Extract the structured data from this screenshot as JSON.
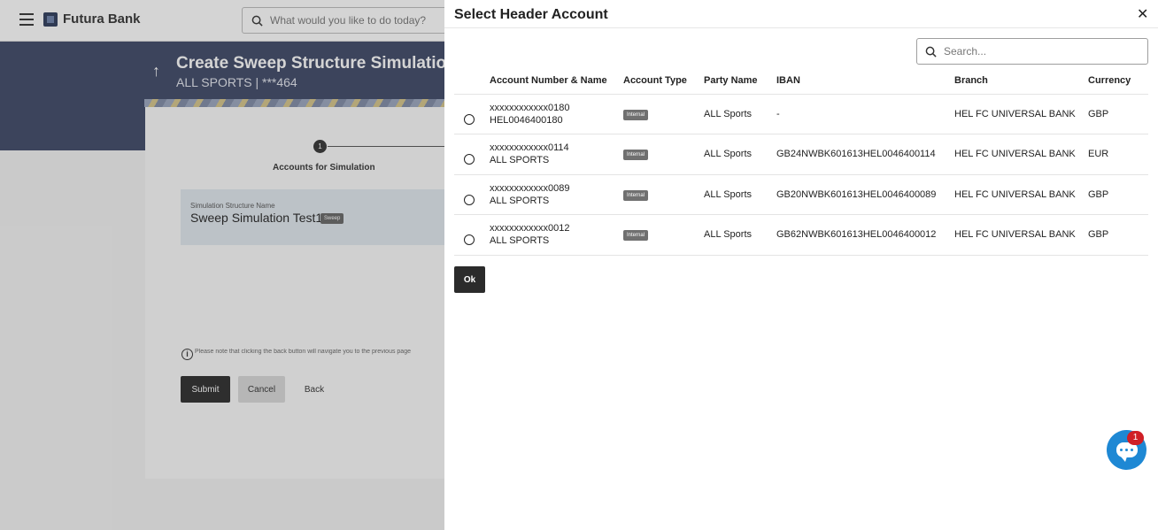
{
  "app": {
    "brand": "Futura Bank",
    "search_placeholder": "What would you like to do today?"
  },
  "page": {
    "title": "Create Sweep Structure Simulation",
    "subtitle": "ALL SPORTS | ***464",
    "step_number": "1",
    "step_label": "Accounts for Simulation",
    "simulation_label": "Simulation Structure Name",
    "simulation_value": "Sweep Simulation Test1",
    "simulation_tag": "Sweep",
    "note": "Please note that clicking the back button will navigate you to the previous page",
    "buttons": {
      "submit": "Submit",
      "cancel": "Cancel",
      "back": "Back"
    }
  },
  "modal": {
    "title": "Select Header Account",
    "search_placeholder": "Search...",
    "columns": [
      "Account Number & Name",
      "Account Type",
      "Party Name",
      "IBAN",
      "Branch",
      "Currency"
    ],
    "rows": [
      {
        "number": "xxxxxxxxxxxx0180",
        "name": "HEL0046400180",
        "type": "Internal",
        "party": "ALL Sports",
        "iban": "-",
        "branch": "HEL FC UNIVERSAL BANK",
        "currency": "GBP"
      },
      {
        "number": "xxxxxxxxxxxx0114",
        "name": "ALL SPORTS",
        "type": "Internal",
        "party": "ALL Sports",
        "iban": "GB24NWBK601613HEL0046400114",
        "branch": "HEL FC UNIVERSAL BANK",
        "currency": "EUR"
      },
      {
        "number": "xxxxxxxxxxxx0089",
        "name": "ALL SPORTS",
        "type": "Internal",
        "party": "ALL Sports",
        "iban": "GB20NWBK601613HEL0046400089",
        "branch": "HEL FC UNIVERSAL BANK",
        "currency": "GBP"
      },
      {
        "number": "xxxxxxxxxxxx0012",
        "name": "ALL SPORTS",
        "type": "Internal",
        "party": "ALL Sports",
        "iban": "GB62NWBK601613HEL0046400012",
        "branch": "HEL FC UNIVERSAL BANK",
        "currency": "GBP"
      }
    ],
    "ok_label": "Ok"
  },
  "chat": {
    "badge_count": "1"
  },
  "colors": {
    "banner": "#3d4766",
    "primary_button": "#2b2b2b",
    "chat": "#1e88d4",
    "badge": "#d01f26"
  }
}
